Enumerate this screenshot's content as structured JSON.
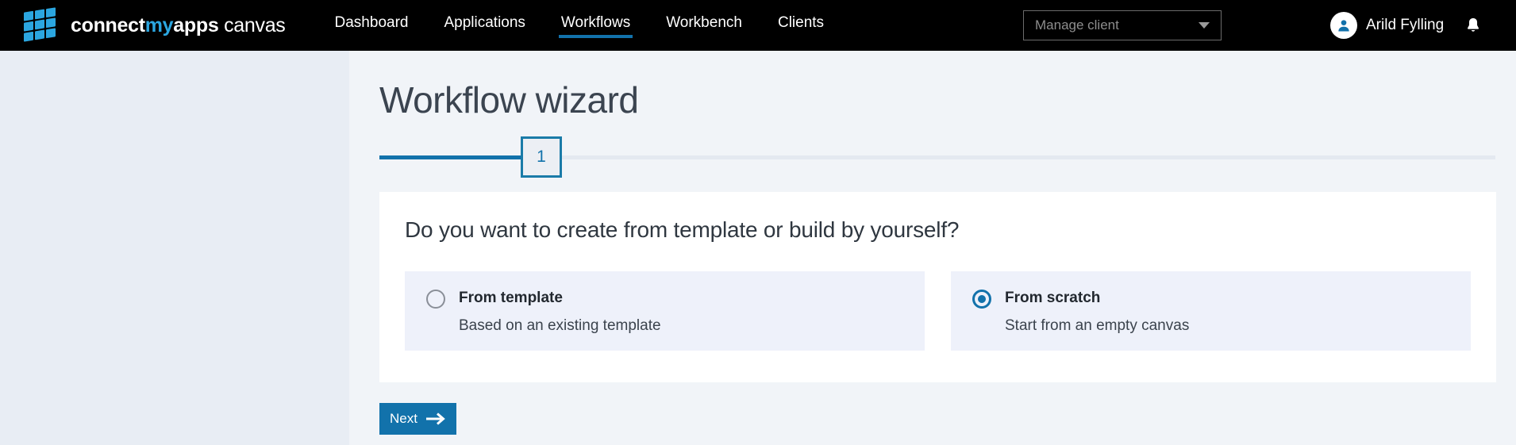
{
  "header": {
    "brand": {
      "part1": "connect",
      "part2": "my",
      "part3": "apps",
      "part4": " canvas",
      "logo_icon": "grid-squares-logo-icon",
      "logo_color": "#2ba6e0"
    },
    "nav": [
      {
        "label": "Dashboard",
        "active": false
      },
      {
        "label": "Applications",
        "active": false
      },
      {
        "label": "Workflows",
        "active": true
      },
      {
        "label": "Workbench",
        "active": false
      },
      {
        "label": "Clients",
        "active": false
      }
    ],
    "client_select": {
      "placeholder": "Manage client",
      "value": "",
      "chevron_icon": "chevron-down-icon"
    },
    "user": {
      "name": "Arild Fylling",
      "avatar_icon": "person-avatar-icon",
      "notification_icon": "bell-icon"
    },
    "background": "#000000",
    "accent": "#1272ab"
  },
  "page": {
    "title": "Workflow wizard",
    "progress": {
      "current_step": "1",
      "total_steps": 1,
      "percent": 13,
      "fill_color": "#1272ab",
      "track_color": "#e4e9f0"
    }
  },
  "card": {
    "heading": "Do you want to create from template or build by yourself?",
    "options": [
      {
        "title": "From template",
        "description": "Based on an existing template",
        "selected": false
      },
      {
        "title": "From scratch",
        "description": "Start from an empty canvas",
        "selected": true
      }
    ]
  },
  "footer": {
    "next_label": "Next",
    "next_icon": "arrow-right-icon"
  },
  "colors": {
    "sidebar_bg": "#e8edf4",
    "content_bg": "#f1f4f8",
    "card_bg": "#ffffff",
    "option_bg": "#eef1fa",
    "accent": "#1272ab",
    "step_border": "#1a7ba8"
  }
}
